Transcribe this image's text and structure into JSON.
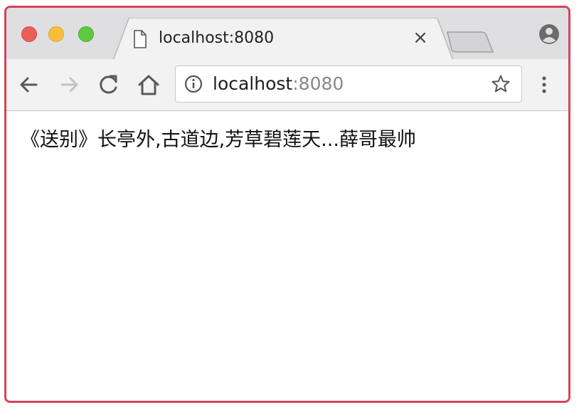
{
  "window": {
    "controls": [
      "close",
      "minimize",
      "maximize"
    ]
  },
  "tab": {
    "title": "localhost:8080",
    "close_glyph": "×",
    "icon": "document-icon"
  },
  "toolbar": {
    "back_icon": "arrow-left-icon",
    "forward_icon": "arrow-right-icon",
    "reload_icon": "reload-icon",
    "home_icon": "home-icon",
    "menu_icon": "more-vertical-icon"
  },
  "address_bar": {
    "host": "localhost",
    "port": ":8080",
    "info_icon": "info-icon",
    "bookmark_icon": "star-icon"
  },
  "page": {
    "text": "《送别》长亭外,古道边,芳草碧莲天...薛哥最帅"
  },
  "colors": {
    "frame_border": "#d8435b",
    "tabstrip_bg": "#dfdfe1",
    "toolbar_bg": "#f2f2f2",
    "close": "#ec5f57",
    "minimize": "#f6be3b",
    "maximize": "#5dc940"
  }
}
